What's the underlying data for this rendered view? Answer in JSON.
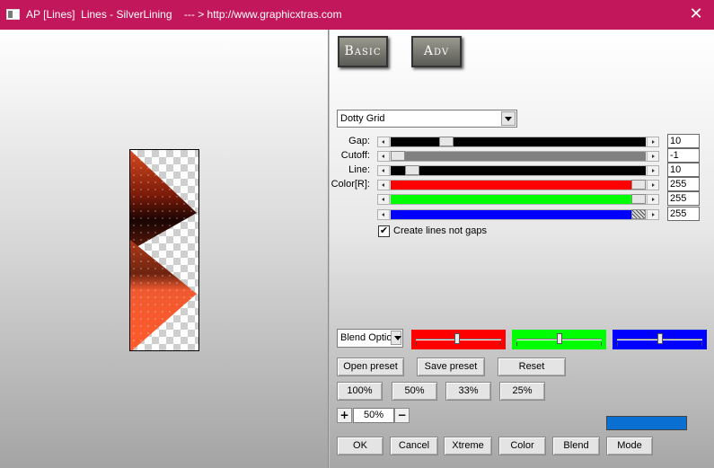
{
  "window": {
    "title": "AP [Lines]  Lines - SilverLining    --- > http://www.graphicxtras.com",
    "close_glyph": "✕"
  },
  "tabs": [
    {
      "label": "Basic"
    },
    {
      "label": "Adv"
    }
  ],
  "pattern_select": {
    "value": "Dotty Grid"
  },
  "sliders": [
    {
      "label": "Gap:",
      "value": "10",
      "fill": "#000000",
      "thumb": 0.2
    },
    {
      "label": "Cutoff:",
      "value": "-1",
      "fill": "#808080",
      "thumb": 0.0
    },
    {
      "label": "Line:",
      "value": "10",
      "fill": "#000000",
      "thumb": 0.06
    },
    {
      "label": "Color[R]:",
      "value": "255",
      "fill": "#ff0000",
      "thumb": 1.0
    },
    {
      "label": "",
      "value": "255",
      "fill": "#00ff00",
      "thumb": 1.0
    },
    {
      "label": "",
      "value": "255",
      "fill": "#0000ff",
      "thumb": 1.0
    }
  ],
  "create_lines_checkbox": {
    "label": "Create lines not gaps",
    "checked": true,
    "glyph": "✔"
  },
  "blend_select": {
    "value": "Blend Optio"
  },
  "color_boxes": [
    {
      "color": "#ff0000",
      "knob": 0.48
    },
    {
      "color": "#00ff00",
      "knob": 0.5
    },
    {
      "color": "#0000ff",
      "knob": 0.5
    }
  ],
  "preset_buttons": {
    "open": "Open preset",
    "save": "Save preset",
    "reset": "Reset"
  },
  "zoom_buttons": [
    "100%",
    "50%",
    "33%",
    "25%"
  ],
  "zoom": {
    "plus": "+",
    "minus": "−",
    "value": "50%"
  },
  "color_swatch": "#0a6fd3",
  "bottom_buttons": [
    "OK",
    "Cancel",
    "Xtreme",
    "Color",
    "Blend",
    "Mode"
  ]
}
